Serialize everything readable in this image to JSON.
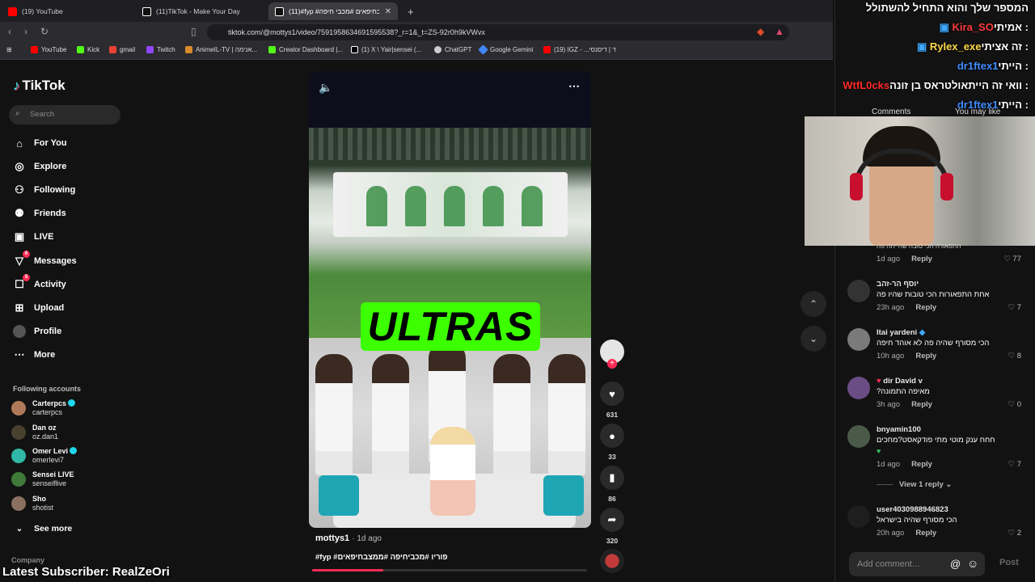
{
  "browser": {
    "tabs": [
      {
        "title": "(19) YouTube",
        "color": "#ff0000"
      },
      {
        "title": "(11)TikTok - Make Your Day",
        "color": "#111111"
      },
      {
        "title": "(11)#fyp #ממצבחיפאים #מכבי חיפה",
        "color": "#111111"
      }
    ],
    "new_tab": "+",
    "url": "tiktok.com/@mottys1/video/7591958634691595538?_r=1&_t=ZS-92r0h9kVWvx",
    "bookmarks": [
      {
        "label": "YouTube",
        "color": "#ff0000"
      },
      {
        "label": "Kick",
        "color": "#53fc18"
      },
      {
        "label": "gmail",
        "color": "#ea4335"
      },
      {
        "label": "Twitch",
        "color": "#9146ff"
      },
      {
        "label": "AnimeIL-TV | אנימה...",
        "color": "#d98b2b"
      },
      {
        "label": "Creator Dashboard |...",
        "color": "#53fc18"
      },
      {
        "label": "(1) X \\ Yair|sensei (...",
        "color": "#000000"
      },
      {
        "label": "ChatGPT",
        "color": "#cccccc"
      },
      {
        "label": "Google Gemini",
        "color": "#4285f4"
      },
      {
        "label": "(19) IGZ - ...ד | דיסנסי",
        "color": "#ff0000"
      }
    ]
  },
  "sidebar": {
    "logo": "TikTok",
    "search_placeholder": "Search",
    "nav": [
      {
        "label": "For You",
        "icon": "home-icon"
      },
      {
        "label": "Explore",
        "icon": "compass-icon"
      },
      {
        "label": "Following",
        "icon": "following-icon"
      },
      {
        "label": "Friends",
        "icon": "friends-icon"
      },
      {
        "label": "LIVE",
        "icon": "live-icon"
      },
      {
        "label": "Messages",
        "icon": "messages-icon",
        "badge": "6"
      },
      {
        "label": "Activity",
        "icon": "activity-icon",
        "badge": "5"
      },
      {
        "label": "Upload",
        "icon": "upload-icon"
      },
      {
        "label": "Profile",
        "icon": "profile-icon"
      },
      {
        "label": "More",
        "icon": "more-icon"
      }
    ],
    "following_title": "Following accounts",
    "accounts": [
      {
        "name": "Carterpcs",
        "handle": "carterpcs",
        "verified": true
      },
      {
        "name": "Dan oz",
        "handle": "oz.dan1",
        "verified": false
      },
      {
        "name": "Omer Levi",
        "handle": "omerlevi7",
        "verified": true
      },
      {
        "name": "Sensei LIVE",
        "handle": "senseiflive",
        "verified": false
      },
      {
        "name": "Sho",
        "handle": "shotist",
        "verified": false
      }
    ],
    "see_more": "See more",
    "company": "Company"
  },
  "video": {
    "overlay_text": "ULTRAS",
    "author": "mottys1",
    "posted": "· 1d ago",
    "hashtags": "#fyp #פוריו #מכביחיפה #ממצבחיפאים",
    "progress": 0.26,
    "likes": "631",
    "comments": "33",
    "saves": "86",
    "shares": "320"
  },
  "stream_chat": [
    {
      "user": "המספר שלך והוא התחיל להשתולל",
      "msg": "",
      "color": "#ffffff"
    },
    {
      "user": "Kira_SO",
      "msg": " : אמיתי",
      "color": "#ff3b3b"
    },
    {
      "user": "Rylex_exe",
      "msg": " : זה אציתי",
      "color": "#ffd84a"
    },
    {
      "user": "dr1ftex1",
      "msg": " : הייתי",
      "color": "#3f8cff"
    },
    {
      "user": "WtfL0cks",
      "msg": " : וואי זה הייתאולטראס בן זונה",
      "color": "#ff2a2a"
    },
    {
      "user": "dr1ftex1",
      "msg": " : הייתי",
      "color": "#3f8cff"
    }
  ],
  "comments_panel": {
    "tab_comments": "Comments",
    "tab_you_may_like": "You may like",
    "items": [
      {
        "user": "",
        "text": "התפאורה הכי טובה שהייתה פה",
        "ago": "1d ago",
        "reply": "Reply",
        "likes": "77"
      },
      {
        "user": "יוסף הר-זהב",
        "text": "אחת התפאורות הכי טובות שהיו פה",
        "ago": "23h ago",
        "reply": "Reply",
        "likes": "7"
      },
      {
        "user": "Itai yardeni",
        "text": "הכי מסורף שהיה פה לא אוהד חיפה",
        "ago": "10h ago",
        "reply": "Reply",
        "likes": "8"
      },
      {
        "user": "dir David v",
        "text": "?מאיפה התמונה",
        "ago": "3h ago",
        "reply": "Reply",
        "likes": "0"
      },
      {
        "user": "bnyamin100",
        "text": "חחח ענק מוטי מתי פודקאסט?מחכים",
        "ago": "1d ago",
        "reply": "Reply",
        "likes": "7"
      },
      {
        "user": "user4030988946823",
        "text": "הכי מסורף שהיה בישראל",
        "ago": "20h ago",
        "reply": "Reply",
        "likes": "2"
      }
    ],
    "view_reply": "View 1 reply",
    "add_comment_placeholder": "Add comment...",
    "post_label": "Post"
  },
  "overlay": {
    "latest_subscriber": "Latest Subscriber: RealZeOri"
  }
}
